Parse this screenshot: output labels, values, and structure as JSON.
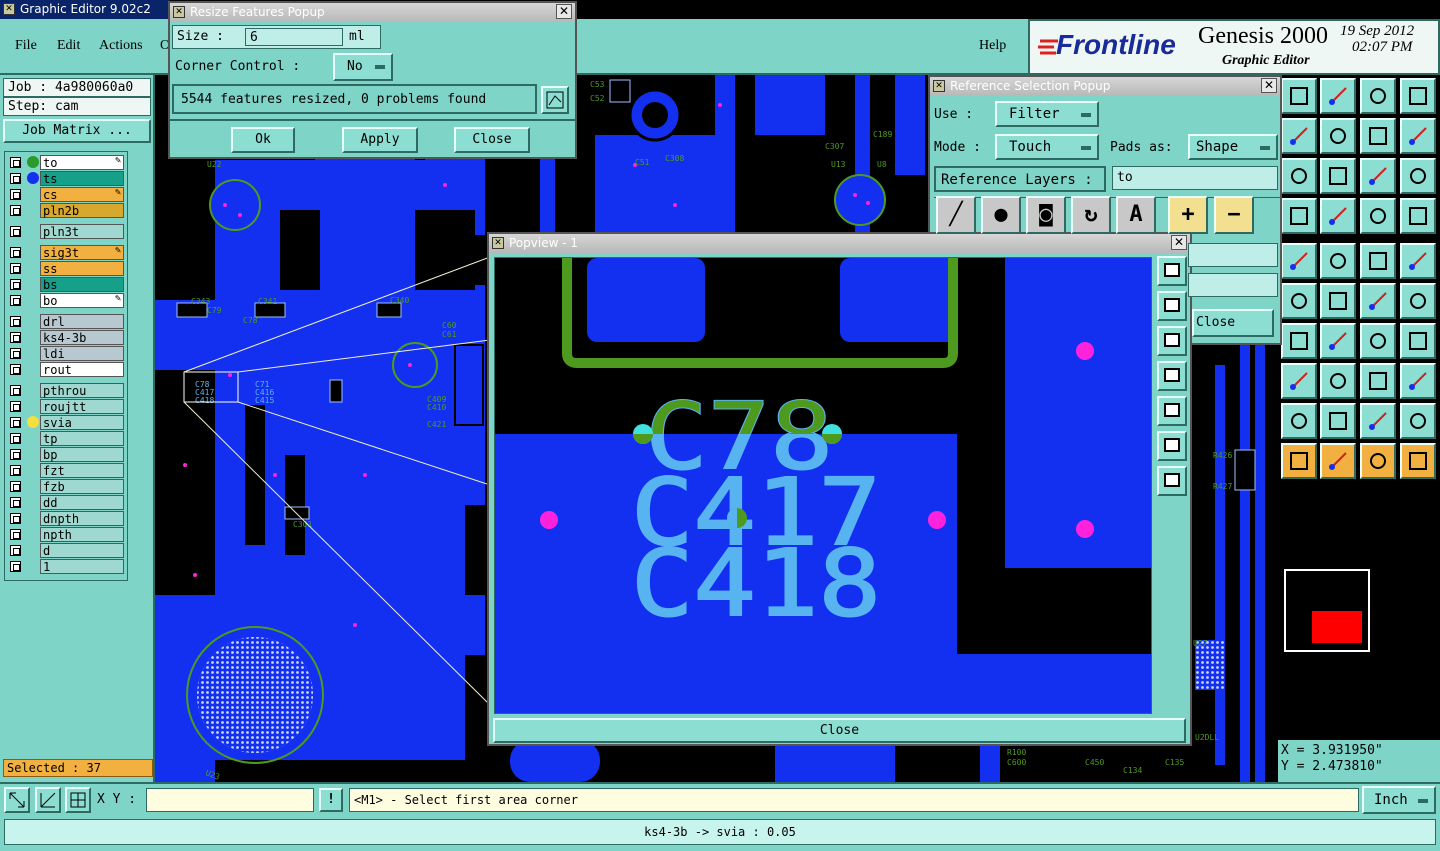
{
  "app": {
    "title": "Graphic Editor 9.02c2 (00",
    "brand": "Frontline",
    "product": "Genesis 2000",
    "subtitle": "Graphic Editor",
    "date": "19 Sep 2012",
    "time": "02:07 PM"
  },
  "menu": {
    "file": "File",
    "edit": "Edit",
    "actions": "Actions",
    "extra": "O",
    "help": "Help"
  },
  "job": {
    "job_label": "Job : 4a980060a0",
    "step_label": "Step: cam",
    "matrix_button": "Job Matrix ..."
  },
  "layers": [
    {
      "name": "to",
      "bg": "#ffffff",
      "dot": "#2a9a2a",
      "edit": true
    },
    {
      "name": "ts",
      "bg": "#16a08a",
      "dot": "#1330f0",
      "edit": false
    },
    {
      "name": "cs",
      "bg": "#f2b040",
      "dot": "",
      "edit": true
    },
    {
      "name": "pln2b",
      "bg": "#d7a72e",
      "dot": "",
      "edit": false
    },
    {
      "name": "pln3t",
      "bg": "#9fd8d0",
      "dot": "",
      "edit": false
    },
    {
      "name": "sig3t",
      "bg": "#f2b040",
      "dot": "",
      "edit": true
    },
    {
      "name": "ss",
      "bg": "#f2b040",
      "dot": "",
      "edit": false
    },
    {
      "name": "bs",
      "bg": "#16a08a",
      "dot": "",
      "edit": false
    },
    {
      "name": "bo",
      "bg": "#ffffff",
      "dot": "",
      "edit": true
    },
    {
      "name": "drl",
      "bg": "#b8c8d0",
      "dot": "",
      "edit": false
    },
    {
      "name": "ks4-3b",
      "bg": "#b8c8d0",
      "dot": "",
      "edit": false
    },
    {
      "name": "ldi",
      "bg": "#b8c8d0",
      "dot": "",
      "edit": false
    },
    {
      "name": "rout",
      "bg": "#ffffff",
      "dot": "",
      "edit": false
    },
    {
      "name": "pthrou",
      "bg": "#9fd8d0",
      "dot": "",
      "edit": false
    },
    {
      "name": "roujtt",
      "bg": "#9fd8d0",
      "dot": "",
      "edit": false
    },
    {
      "name": "svia",
      "bg": "#9fd8d0",
      "dot": "#f2e040",
      "edit": false
    },
    {
      "name": "tp",
      "bg": "#9fd8d0",
      "dot": "",
      "edit": false
    },
    {
      "name": "bp",
      "bg": "#9fd8d0",
      "dot": "",
      "edit": false
    },
    {
      "name": "fzt",
      "bg": "#9fd8d0",
      "dot": "",
      "edit": false
    },
    {
      "name": "fzb",
      "bg": "#9fd8d0",
      "dot": "",
      "edit": false
    },
    {
      "name": "dd",
      "bg": "#9fd8d0",
      "dot": "",
      "edit": false
    },
    {
      "name": "dnpth",
      "bg": "#9fd8d0",
      "dot": "",
      "edit": false
    },
    {
      "name": "npth",
      "bg": "#9fd8d0",
      "dot": "",
      "edit": false
    },
    {
      "name": "d",
      "bg": "#9fd8d0",
      "dot": "",
      "edit": false
    },
    {
      "name": "1",
      "bg": "#9fd8d0",
      "dot": "",
      "edit": false
    }
  ],
  "selected": "Selected : 37",
  "resize_popup": {
    "title": "Resize Features Popup",
    "size_label": "Size :",
    "size_value": "6",
    "size_unit": "ml",
    "corner_label": "Corner Control :",
    "corner_value": "No",
    "message": "5544 features resized, 0 problems found",
    "ok": "Ok",
    "apply": "Apply",
    "close": "Close"
  },
  "reference_popup": {
    "title": "Reference Selection Popup",
    "use_label": "Use :",
    "use_value": "Filter",
    "mode_label": "Mode :",
    "mode_value": "Touch",
    "pads_label": "Pads as:",
    "pads_value": "Shape",
    "ref_layers_label": "Reference Layers :",
    "ref_layers_value": "to",
    "close": "Close"
  },
  "popview": {
    "title": "Popview - 1",
    "close": "Close",
    "labels": {
      "a": "C78",
      "b": "C417",
      "c": "C418"
    }
  },
  "board_labels": {
    "c343": "C343",
    "c341": "C341",
    "c79": "C79",
    "c78": "C78",
    "c340": "C340",
    "c60": "C60",
    "c61": "C61",
    "c417": "C417",
    "c418": "C418",
    "c415": "C415",
    "c416": "C416",
    "c44": "C44",
    "c409": "C409",
    "c410": "C410",
    "c421": "C421",
    "u22": "U22",
    "c53": "C53",
    "c52": "C52",
    "r35": "R35",
    "c43": "C43",
    "c307": "C307",
    "c189": "C189",
    "u13": "U13",
    "u8": "U8",
    "c308": "C308",
    "c51": "C51",
    "c301": "C301",
    "r143": "R143",
    "u23": "U23",
    "r426": "R426",
    "r427": "R427",
    "u27": "U27",
    "r100": "R100",
    "c600": "C600",
    "c450": "C450",
    "c134": "C134",
    "c135": "C135",
    "u2dll": "U2DLL",
    "ck5": "CK5"
  },
  "coords": {
    "x": "X = 3.931950\"",
    "y": "Y = 2.473810\""
  },
  "status": {
    "xy_label": "X Y :",
    "xy_value": "",
    "prompt": "<M1> - Select first area corner",
    "units": "Inch",
    "bottom": "ks4-3b -> svia : 0.05"
  },
  "colors": {
    "teal": "#7fd4c8",
    "board_blue": "#1330f0",
    "magenta": "#ff22dd",
    "silk_green": "#4e9a1e",
    "silk_cyan": "#58b4f0"
  }
}
